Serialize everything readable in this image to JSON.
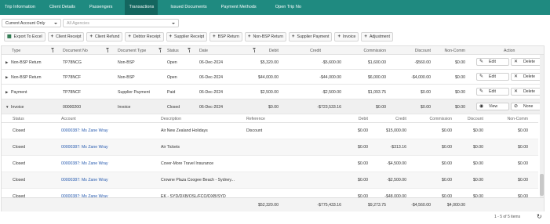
{
  "nav": {
    "tabs": [
      "Trip Information",
      "Client Details",
      "Passengers",
      "Transactions",
      "Issued Documents",
      "Payment Methods",
      "Open Trip No"
    ],
    "active_index": 3
  },
  "filters": {
    "account": "Current Account Only",
    "agencies_placeholder": "All Agencies"
  },
  "toolbar": {
    "buttons": [
      {
        "icon": "excel-icon",
        "label": "Export To Excel"
      },
      {
        "icon": "plus-icon",
        "label": "Client Receipt"
      },
      {
        "icon": "plus-icon",
        "label": "Client Refund"
      },
      {
        "icon": "plus-icon",
        "label": "Debtor Receipt"
      },
      {
        "icon": "plus-icon",
        "label": "Supplier Receipt"
      },
      {
        "icon": "plus-icon",
        "label": "BSP Return"
      },
      {
        "icon": "plus-icon",
        "label": "Non-BSP Return"
      },
      {
        "icon": "plus-icon",
        "label": "Supplier Payment"
      },
      {
        "icon": "plus-icon",
        "label": "Invoice"
      },
      {
        "icon": "plus-icon",
        "label": "Adjustment"
      }
    ]
  },
  "grid": {
    "columns": [
      "Type",
      "Document No",
      "Document Type",
      "Status",
      "Date",
      "Debit",
      "Credit",
      "Commission",
      "Discount",
      "Non-Comm",
      "Action"
    ],
    "rows": [
      {
        "type": "Non-BSP Return",
        "doc_no": "TP78NCG",
        "doc_type": "Non-BSP",
        "status": "Open",
        "date": "06-Dec-2024",
        "debit": "$5,320.00",
        "credit": "-$5,600.00",
        "commission": "$1,600.00",
        "discount": "-$560.00",
        "noncomm": "$0.00",
        "btn1": "Edit",
        "btn2": "Delete",
        "expanded": false
      },
      {
        "type": "Non-BSP Return",
        "doc_no": "TP78NCF",
        "doc_type": "Non-BSP",
        "status": "Open",
        "date": "06-Dec-2024",
        "debit": "$44,000.00",
        "credit": "-$44,000.00",
        "commission": "$6,000.00",
        "discount": "-$4,000.00",
        "noncomm": "$0.00",
        "btn1": "Edit",
        "btn2": "Delete",
        "expanded": false
      },
      {
        "type": "Payment",
        "doc_no": "TP78NCF",
        "doc_type": "Supplier Payment",
        "status": "Paid",
        "date": "06-Dec-2024",
        "debit": "$2,500.00",
        "credit": "-$2,500.00",
        "commission": "$1,093.75",
        "discount": "$0.00",
        "noncomm": "$0.00",
        "btn1": "Edit",
        "btn2": "Delete",
        "expanded": false
      },
      {
        "type": "Invoice",
        "doc_no": "00000200",
        "doc_type": "Invoice",
        "status": "Closed",
        "date": "06-Dec-2024",
        "debit": "$0.00",
        "credit": "-$723,533.16",
        "commission": "$0.00",
        "discount": "$0.00",
        "noncomm": "$0.00",
        "btn1": "View",
        "btn2": "None",
        "expanded": true
      }
    ],
    "detail": {
      "columns": [
        "Status",
        "Account",
        "Description",
        "Reference",
        "Debit",
        "Credit",
        "Commission",
        "Discount",
        "Non-Comm"
      ],
      "rows": [
        {
          "status": "Closed",
          "account": "00000387: Ms Zane Wray",
          "description": "Air New Zealand Holidays",
          "reference": "Discount",
          "debit": "$0.00",
          "credit": "$15,000.00",
          "commission": "$0.00",
          "discount": "$0.00",
          "noncomm": "$0.00"
        },
        {
          "status": "Closed",
          "account": "00000387: Ms Zane Wray",
          "description": "Air Tickets",
          "reference": "",
          "debit": "$0.00",
          "credit": "-$313.16",
          "commission": "$0.00",
          "discount": "$0.00",
          "noncomm": "$0.00"
        },
        {
          "status": "Closed",
          "account": "00000387: Ms Zane Wray",
          "description": "Cover-More Travel Insurance",
          "reference": "",
          "debit": "$0.00",
          "credit": "-$4,500.00",
          "commission": "$0.00",
          "discount": "$0.00",
          "noncomm": "$0.00"
        },
        {
          "status": "Closed",
          "account": "00000387: Ms Zane Wray",
          "description": "Crowne Plaza Coogee Beach - Sydney...",
          "reference": "",
          "debit": "$0.00",
          "credit": "-$2,500.00",
          "commission": "$0.00",
          "discount": "$0.00",
          "noncomm": "$0.00"
        },
        {
          "status": "Closed",
          "account": "00000387: Ms Zane Wray",
          "description": "EK - SYD/DXB/OSL/FCO/DXB/SYD",
          "reference": "",
          "debit": "$0.00",
          "credit": "-$48,000.00",
          "commission": "$0.00",
          "discount": "$0.00",
          "noncomm": "$0.00"
        }
      ]
    },
    "totals": {
      "debit": "$52,320.00",
      "credit": "-$775,433.16",
      "commission": "$9,273.75",
      "discount": "-$4,560.00",
      "noncomm": "$4,000.00"
    }
  },
  "pager": {
    "text": "1 - 5 of 5 items"
  }
}
